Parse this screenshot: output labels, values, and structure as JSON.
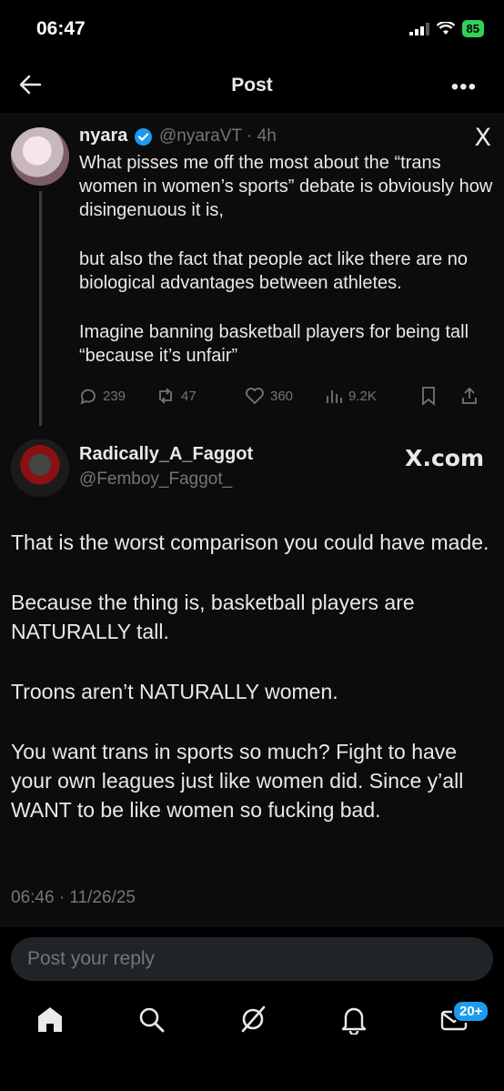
{
  "status_bar": {
    "time": "06:47",
    "battery": "85"
  },
  "header": {
    "title": "Post"
  },
  "tweet1": {
    "name": "nyara",
    "handle_time": "@nyaraVT · 4h",
    "paragraphs": [
      "What pisses me off the most about the “trans women in women’s sports” debate is obviously how disingenuous it is,",
      "but also the fact that people act like there are no biological advantages between athletes.",
      "Imagine banning basketball players for being tall “because it’s unfair”"
    ],
    "replies": "239",
    "reposts": "47",
    "likes": "360",
    "views": "9.2K",
    "x_logo": "X"
  },
  "tweet2": {
    "name": "Radically_A_Faggot",
    "handle": "@Femboy_Faggot_",
    "site": "X.com",
    "paragraphs": [
      "That is the worst comparison you could have made.",
      "Because the thing is, basketball players are NATURALLY tall.",
      "Troons aren’t NATURALLY women.",
      "You want trans in sports so much? Fight to have your own leagues just like women did. Since y’all WANT to be like women so fucking bad."
    ],
    "timestamp": "06:46 · 11/26/25"
  },
  "reply": {
    "placeholder": "Post your reply"
  },
  "tabbar": {
    "badge": "20+"
  },
  "colors": {
    "accent": "#1d9bf0",
    "battery": "#30d158",
    "muted": "#71767b"
  }
}
